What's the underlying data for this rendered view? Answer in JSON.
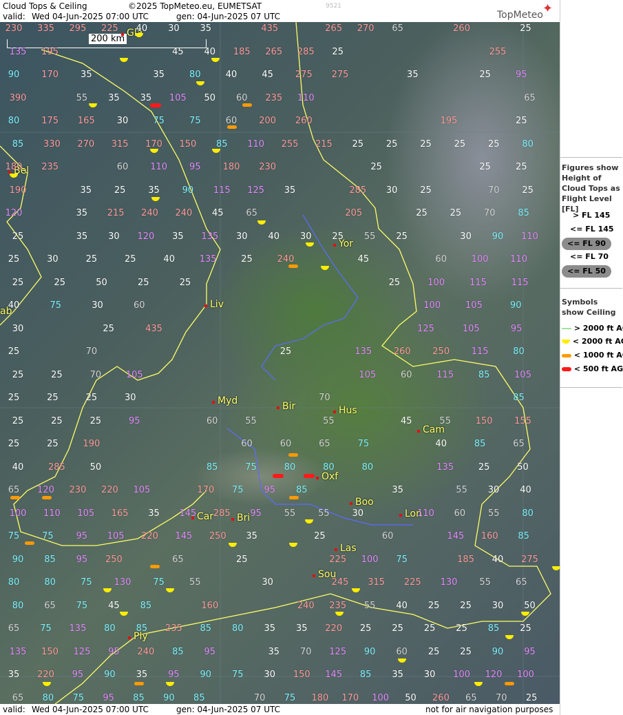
{
  "header": {
    "title": "Cloud Tops & Ceiling",
    "copyright": "©2025 TopMeteo.eu, EUMETSAT",
    "code": "9521",
    "valid_label": "valid:",
    "valid_value": "Wed  04-Jun-2025  07:00 UTC",
    "gen": "gen: 04-Jun-2025 07 UTC",
    "brand": "TopMeteo"
  },
  "scale_bar": "200 km",
  "footer": {
    "valid_label": "valid:",
    "valid_value": "Wed  04-Jun-2025  07:00 UTC",
    "gen": "gen: 04-Jun-2025 07 UTC",
    "disclaimer": "not for air navigation purposes"
  },
  "legend": {
    "figures_title": "Figures show Height of Cloud Tops as Flight Level  [FL]",
    "levels": [
      {
        "label": "> FL 145",
        "color": "#ff9d9d"
      },
      {
        "label": "<= FL 145",
        "color": "#e58cff"
      },
      {
        "label": "<= FL 90",
        "color": "#7ff3ff"
      },
      {
        "label": "<= FL 70",
        "color": "#d6d6d6"
      },
      {
        "label": "<= FL 50",
        "color": "#ffffff"
      }
    ],
    "symbols_title": "Symbols show Ceiling",
    "symbols": [
      {
        "label": "> 2000 ft AGL",
        "color": "#9be49b"
      },
      {
        "label": "< 2000 ft AGL",
        "color": "#ffee00"
      },
      {
        "label": "< 1000 ft AGL",
        "color": "#ff9a00"
      },
      {
        "label": "< 500 ft AGL",
        "color": "#ff1a1a"
      }
    ]
  },
  "cities": [
    "Gla",
    "Bel",
    "Yor",
    "Liv",
    "Myd",
    "Bir",
    "Hus",
    "Cam",
    "Oxf",
    "Boo",
    "Lon",
    "Car",
    "Bri",
    "Las",
    "Sou",
    "Ply",
    "ab"
  ],
  "rows": [
    [
      "230",
      "335",
      "295",
      "225",
      "40",
      "30",
      "35",
      "",
      "435",
      "",
      "265",
      "270",
      "65",
      "",
      "260",
      "",
      "25"
    ],
    [
      "135",
      "195",
      "",
      "",
      "",
      "45",
      "40",
      "185",
      "265",
      "285",
      "25",
      "",
      "",
      "",
      "",
      "255",
      ""
    ],
    [
      "90",
      "170",
      "35",
      "",
      "35",
      "80",
      "40",
      "45",
      "275",
      "275",
      "",
      "35",
      "",
      "25",
      "95"
    ],
    [
      "390",
      "",
      "55",
      "35",
      "35",
      "105",
      "50",
      "60",
      "235",
      "110",
      "",
      "",
      "",
      "",
      "",
      "",
      "65"
    ],
    [
      "80",
      "175",
      "165",
      "30",
      "75",
      "75",
      "60",
      "200",
      "260",
      "",
      "",
      "",
      "195",
      "",
      "25"
    ],
    [
      "85",
      "330",
      "270",
      "315",
      "170",
      "150",
      "85",
      "110",
      "255",
      "215",
      "25",
      "25",
      "25",
      "25",
      "25",
      "80"
    ],
    [
      "180",
      "235",
      "",
      "60",
      "110",
      "95",
      "180",
      "230",
      "",
      "",
      "25",
      "",
      "",
      "25",
      "25"
    ],
    [
      "190",
      "",
      "35",
      "25",
      "35",
      "90",
      "115",
      "125",
      "35",
      "",
      "285",
      "30",
      "25",
      "",
      "70",
      "25"
    ],
    [
      "120",
      "",
      "35",
      "215",
      "240",
      "240",
      "45",
      "65",
      "",
      "",
      "205",
      "",
      "25",
      "25",
      "70",
      "85"
    ],
    [
      "25",
      "",
      "35",
      "30",
      "120",
      "35",
      "135",
      "30",
      "40",
      "30",
      "25",
      "55",
      "25",
      "",
      "30",
      "90",
      "110"
    ],
    [
      "25",
      "30",
      "25",
      "25",
      "40",
      "135",
      "25",
      "240",
      "",
      "45",
      "",
      "60",
      "100",
      "110"
    ],
    [
      "25",
      "25",
      "50",
      "25",
      "25",
      "",
      "",
      "",
      "",
      "25",
      "100",
      "115",
      "115"
    ],
    [
      "40",
      "75",
      "30",
      "60",
      "",
      "",
      "",
      "",
      "",
      "",
      "100",
      "105",
      "90"
    ],
    [
      "30",
      "",
      "25",
      "435",
      "",
      "",
      "",
      "",
      "",
      "125",
      "105",
      "95"
    ],
    [
      "25",
      "",
      "70",
      "",
      "",
      "",
      "",
      "25",
      "",
      "135",
      "260",
      "250",
      "115",
      "80"
    ],
    [
      "25",
      "25",
      "70",
      "105",
      "",
      "",
      "",
      "",
      "",
      "105",
      "60",
      "115",
      "85",
      "105"
    ],
    [
      "25",
      "25",
      "25",
      "30",
      "",
      "",
      "",
      "",
      "70",
      "",
      "",
      "",
      "",
      "85"
    ],
    [
      "25",
      "25",
      "25",
      "95",
      "",
      "60",
      "55",
      "",
      "55",
      "",
      "45",
      "55",
      "150",
      "155"
    ],
    [
      "25",
      "25",
      "190",
      "",
      "",
      "",
      "60",
      "60",
      "65",
      "75",
      "",
      "40",
      "85",
      "65"
    ],
    [
      "40",
      "285",
      "50",
      "",
      "",
      "85",
      "75",
      "80",
      "80",
      "80",
      "",
      "135",
      "25",
      "50"
    ],
    [
      "65",
      "120",
      "230",
      "220",
      "105",
      "",
      "170",
      "75",
      "95",
      "85",
      "",
      "",
      "35",
      "",
      "55",
      "30",
      "40"
    ],
    [
      "100",
      "110",
      "105",
      "165",
      "35",
      "145",
      "285",
      "95",
      "55",
      "55",
      "30",
      "",
      "110",
      "60",
      "55",
      "80"
    ],
    [
      "75",
      "75",
      "95",
      "105",
      "220",
      "145",
      "250",
      "35",
      "",
      "25",
      "",
      "60",
      "",
      "145",
      "160",
      "85"
    ],
    [
      "90",
      "85",
      "95",
      "250",
      "",
      "65",
      "",
      "25",
      "",
      "",
      "225",
      "100",
      "75",
      "",
      "185",
      "40",
      "275"
    ],
    [
      "80",
      "80",
      "75",
      "130",
      "75",
      "55",
      "",
      "30",
      "",
      "245",
      "315",
      "225",
      "130",
      "55",
      "65"
    ],
    [
      "80",
      "65",
      "75",
      "45",
      "85",
      "",
      "160",
      "",
      "",
      "240",
      "235",
      "55",
      "40",
      "25",
      "25",
      "30",
      "50"
    ],
    [
      "65",
      "75",
      "135",
      "80",
      "85",
      "235",
      "85",
      "80",
      "35",
      "35",
      "220",
      "25",
      "25",
      "25",
      "25",
      "85",
      "25"
    ],
    [
      "135",
      "150",
      "125",
      "95",
      "240",
      "85",
      "95",
      "",
      "35",
      "70",
      "125",
      "90",
      "60",
      "25",
      "25",
      "90",
      "95"
    ],
    [
      "35",
      "220",
      "95",
      "90",
      "35",
      "95",
      "90",
      "75",
      "30",
      "150",
      "145",
      "85",
      "35",
      "30",
      "100",
      "120",
      "100"
    ],
    [
      "65",
      "80",
      "75",
      "95",
      "85",
      "90",
      "85",
      "",
      "70",
      "75",
      "180",
      "170",
      "100",
      "50",
      "260",
      "65",
      "70",
      "25"
    ]
  ]
}
